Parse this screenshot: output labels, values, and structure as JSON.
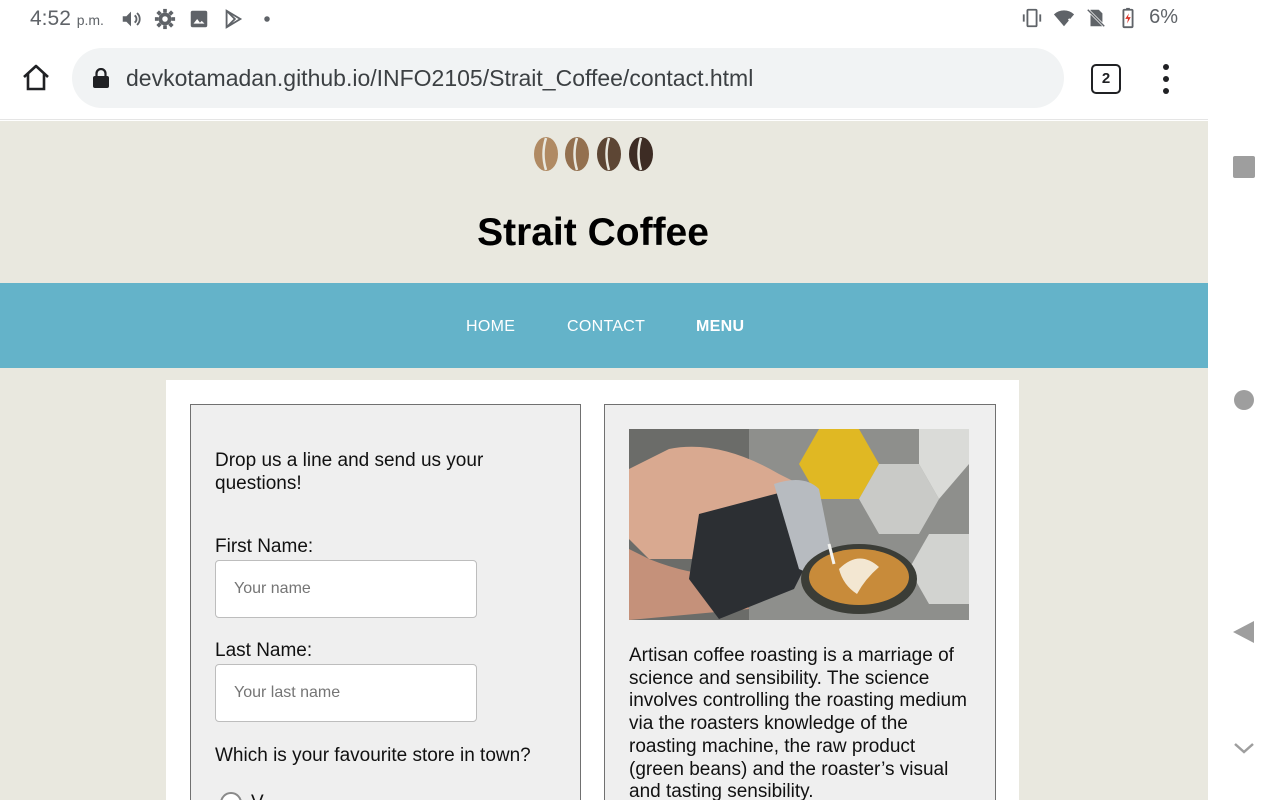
{
  "status_bar": {
    "time": "4:52",
    "time_suffix": "p.m.",
    "battery": "6%",
    "icons": [
      "volume-icon",
      "settings-icon",
      "image-icon",
      "play-store-icon",
      "dot-icon",
      "vibrate-icon",
      "wifi-icon",
      "no-sim-icon",
      "battery-charging-icon"
    ]
  },
  "browser": {
    "url": "devkotamadan.github.io/INFO2105/Strait_Coffee/contact.html",
    "tab_count": "2"
  },
  "site": {
    "title": "Strait Coffee",
    "nav": [
      {
        "label": "HOME"
      },
      {
        "label": "CONTACT"
      },
      {
        "label": "MENU"
      }
    ]
  },
  "form": {
    "intro": "Drop us a line and send us your questions!",
    "first_name_label": "First Name:",
    "first_name_placeholder": "Your name",
    "last_name_label": "Last Name:",
    "last_name_placeholder": "Your last name",
    "store_question": "Which is your favourite store in town?",
    "first_option_partial": "V"
  },
  "article": {
    "text": "Artisan coffee roasting is a marriage of science and sensibility. The science involves controlling the roasting medium via the roasters knowledge of the roasting machine, the raw product (green beans) and the roaster’s visual and tasting sensibility."
  },
  "colors": {
    "nav_bg": "#64b3c9",
    "page_bg": "#e9e8df",
    "panel_bg": "#efefef"
  }
}
